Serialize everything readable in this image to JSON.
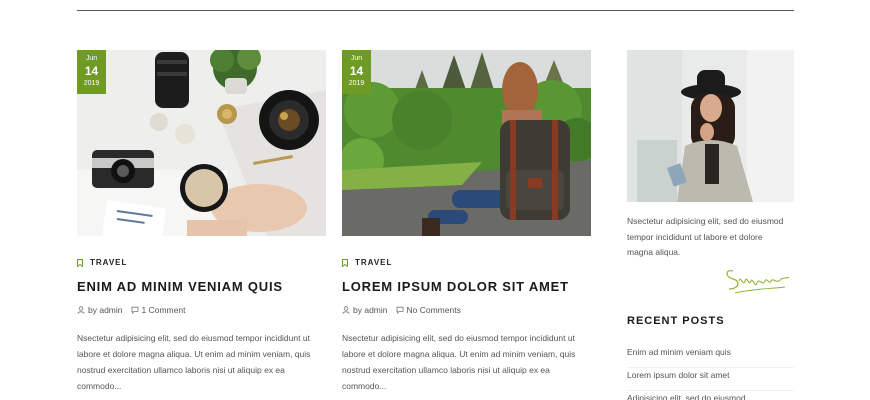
{
  "posts": [
    {
      "date": {
        "month": "Jun",
        "day": "14",
        "year": "2019"
      },
      "category": "TRAVEL",
      "title": "ENIM AD MINIM VENIAM QUIS",
      "author": "by admin",
      "comments": "1 Comment",
      "excerpt": [
        "Nsectetur adipisicing elit, sed do eiusmod tempor incididunt ut",
        "labore et dolore magna aliqua. Ut enim ad minim veniam, quis",
        "nostrud exercitation ullamco laboris nisi ut aliquip ex ea",
        "commodo..."
      ]
    },
    {
      "date": {
        "month": "Jun",
        "day": "14",
        "year": "2019"
      },
      "category": "TRAVEL",
      "title": "LOREM IPSUM DOLOR SIT AMET",
      "author": "by admin",
      "comments": "No Comments",
      "excerpt": [
        "Nsectetur adipisicing elit, sed do eiusmod tempor incididunt ut",
        "labore et dolore magna aliqua. Ut enim ad minim veniam, quis",
        "nostrud exercitation ullamco laboris nisi ut aliquip ex ea",
        "commodo..."
      ]
    }
  ],
  "sidebar": {
    "about_text": [
      "Nsectetur adipisicing elit, sed do eiusmod",
      "tempor incididunt ut labore et dolore",
      "magna aliqua."
    ],
    "signature": "Signature",
    "recent_title": "RECENT POSTS",
    "recent_posts": [
      "Enim ad minim veniam quis",
      "Lorem ipsum dolor sit amet",
      "Adipisicing elit, sed do eiusmod"
    ]
  },
  "colors": {
    "accent": "#6f9a24",
    "text": "#555555",
    "heading": "#1a1a1a"
  },
  "icons": {
    "category": "bookmark-icon",
    "author": "user-icon",
    "comments": "comment-icon"
  }
}
